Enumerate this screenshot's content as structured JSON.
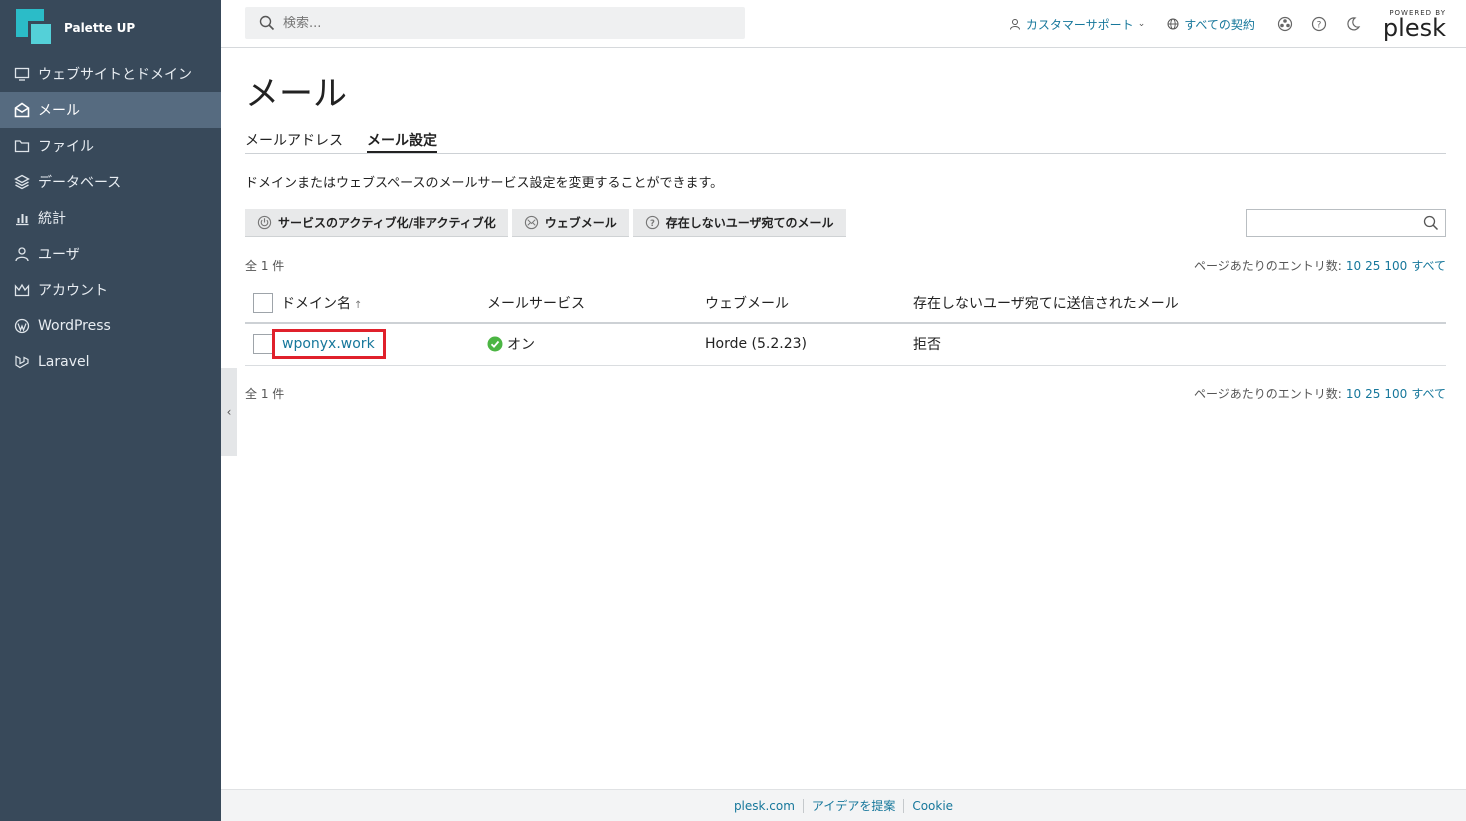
{
  "brand": {
    "name": "Palette UP"
  },
  "sidebar": {
    "items": [
      {
        "label": "ウェブサイトとドメイン",
        "icon": "monitor-icon"
      },
      {
        "label": "メール",
        "icon": "mail-icon",
        "active": true
      },
      {
        "label": "ファイル",
        "icon": "folder-icon"
      },
      {
        "label": "データベース",
        "icon": "database-icon"
      },
      {
        "label": "統計",
        "icon": "bar-chart-icon"
      },
      {
        "label": "ユーザ",
        "icon": "user-icon"
      },
      {
        "label": "アカウント",
        "icon": "crown-icon"
      },
      {
        "label": "WordPress",
        "icon": "wordpress-icon"
      },
      {
        "label": "Laravel",
        "icon": "laravel-icon"
      }
    ]
  },
  "topbar": {
    "search_placeholder": "検索...",
    "support_label": "カスタマーサポート",
    "subscriptions_label": "すべての契約",
    "powered_by": "POWERED BY",
    "plesk": "plesk"
  },
  "page": {
    "title": "メール",
    "tabs": [
      {
        "label": "メールアドレス",
        "active": false
      },
      {
        "label": "メール設定",
        "active": true
      }
    ],
    "description": "ドメインまたはウェブスペースのメールサービス設定を変更することができます。"
  },
  "toolbar": {
    "toggle_label": "サービスのアクティブ化/非アクティブ化",
    "webmail_label": "ウェブメール",
    "nonexistent_label": "存在しないユーザ宛てのメール"
  },
  "list": {
    "total": "全 1 件",
    "per_page_label": "ページあたりのエントリ数:",
    "per_page_10": "10",
    "per_page_25": "25",
    "per_page_100": "100",
    "per_page_all": "すべて",
    "columns": {
      "domain": "ドメイン名",
      "sort_arrow": "↑",
      "mail_service": "メールサービス",
      "webmail": "ウェブメール",
      "nonexistent": "存在しないユーザ宛てに送信されたメール"
    },
    "rows": [
      {
        "domain": "wponyx.work",
        "mail_service": "オン",
        "webmail": "Horde (5.2.23)",
        "nonexistent": "拒否"
      }
    ]
  },
  "footer": {
    "link1": "plesk.com",
    "link2": "アイデアを提案",
    "link3": "Cookie"
  },
  "colors": {
    "sidebar": "#38495a",
    "accent": "#16779b",
    "highlight": "#e0202b",
    "status_ok": "#4bb543"
  }
}
